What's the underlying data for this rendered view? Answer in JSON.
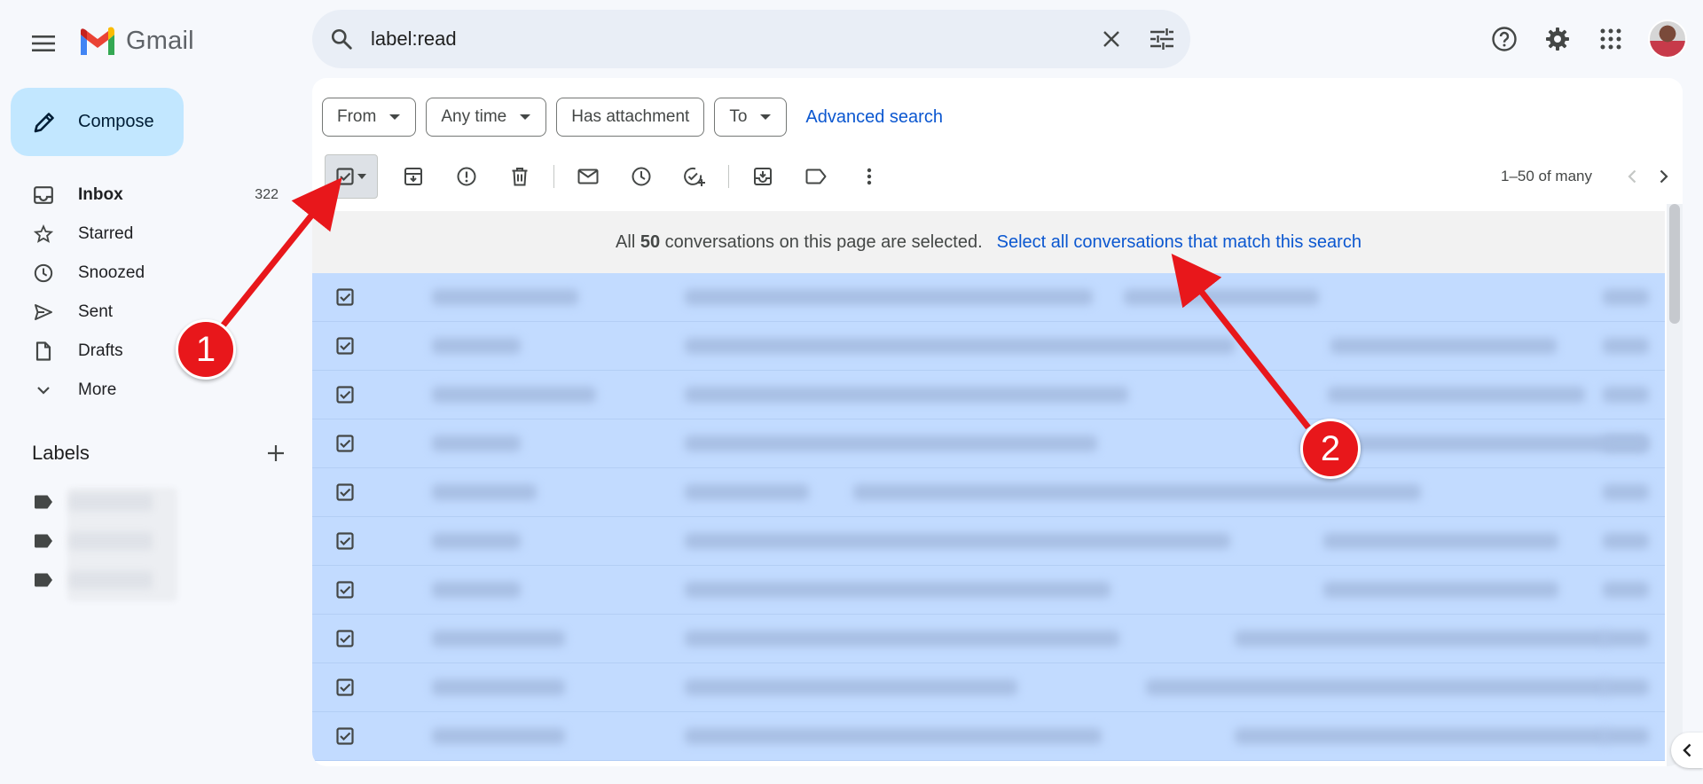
{
  "app": {
    "name": "Gmail"
  },
  "search": {
    "query": "label:read"
  },
  "filters": {
    "chips": [
      {
        "label": "From",
        "dropdown": true
      },
      {
        "label": "Any time",
        "dropdown": true
      },
      {
        "label": "Has attachment",
        "dropdown": false
      },
      {
        "label": "To",
        "dropdown": true
      }
    ],
    "advanced": "Advanced search"
  },
  "compose": {
    "label": "Compose"
  },
  "nav": [
    {
      "label": "Inbox",
      "count": "322",
      "icon": "inbox-icon",
      "bold": true
    },
    {
      "label": "Starred",
      "count": "",
      "icon": "star-icon"
    },
    {
      "label": "Snoozed",
      "count": "",
      "icon": "clock-icon"
    },
    {
      "label": "Sent",
      "count": "",
      "icon": "send-icon"
    },
    {
      "label": "Drafts",
      "count": "",
      "icon": "draft-icon"
    },
    {
      "label": "More",
      "count": "",
      "icon": "chevron-down-icon"
    }
  ],
  "labels": {
    "title": "Labels",
    "count": 3
  },
  "pager": {
    "text": "1–50 of many"
  },
  "banner": {
    "prefix": "All",
    "count": "50",
    "suffix": "conversations on this page are selected.",
    "link": "Select all conversations that match this search"
  },
  "callouts": [
    "1",
    "2"
  ],
  "colors": {
    "accent": "#0b57d0",
    "selected_row": "#c2dbff",
    "compose": "#c2e7ff",
    "callout": "#e8171b"
  }
}
